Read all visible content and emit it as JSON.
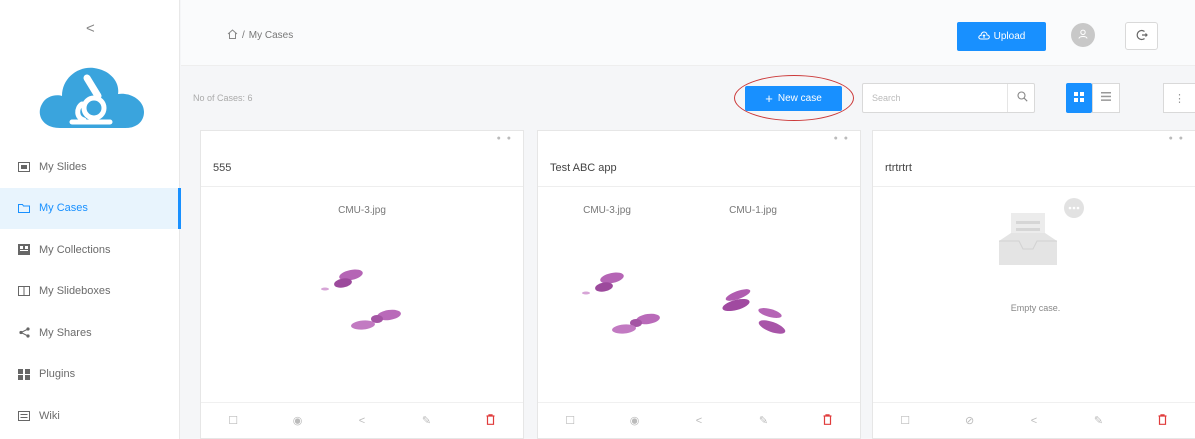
{
  "sidebar": {
    "collapse_icon": "chevron-left-icon",
    "items": [
      {
        "label": "My Slides",
        "icon": "slides-icon",
        "active": false
      },
      {
        "label": "My Cases",
        "icon": "folder-icon",
        "active": true
      },
      {
        "label": "My Collections",
        "icon": "collections-icon",
        "active": false
      },
      {
        "label": "My Slideboxes",
        "icon": "slidebox-icon",
        "active": false
      },
      {
        "label": "My Shares",
        "icon": "share-icon",
        "active": false
      },
      {
        "label": "Plugins",
        "icon": "plugins-icon",
        "active": false
      },
      {
        "label": "Wiki",
        "icon": "wiki-icon",
        "active": false
      }
    ]
  },
  "header": {
    "breadcrumb_home_icon": "home-icon",
    "breadcrumb_separator": "/",
    "breadcrumb_current": "My Cases",
    "upload_label": "Upload",
    "upload_icon": "cloud-upload-icon",
    "avatar_icon": "user-icon",
    "logout_icon": "logout-icon"
  },
  "toolbar": {
    "case_count": "No of Cases: 6",
    "new_case_label": "New case",
    "search_placeholder": "Search",
    "grid_view_icon": "grid-view-icon",
    "list_view_icon": "list-view-icon",
    "more_icon": "more-vertical-icon"
  },
  "cards": [
    {
      "title": "555",
      "thumbnails": [
        "CMU-3.jpg"
      ],
      "empty": false
    },
    {
      "title": "Test ABC app",
      "thumbnails": [
        "CMU-3.jpg",
        "CMU-1.jpg"
      ],
      "empty": false
    },
    {
      "title": "rtrtrtrt",
      "thumbnails": [],
      "empty": true,
      "empty_text": "Empty case."
    }
  ],
  "card_action_icons": [
    "select-icon",
    "visibility-icon",
    "share-icon",
    "edit-icon",
    "delete-icon"
  ],
  "colors": {
    "accent": "#1890ff",
    "delete": "#e03b3b",
    "annotation_ring": "#cc3a3a",
    "tissue": "#b565b5"
  }
}
